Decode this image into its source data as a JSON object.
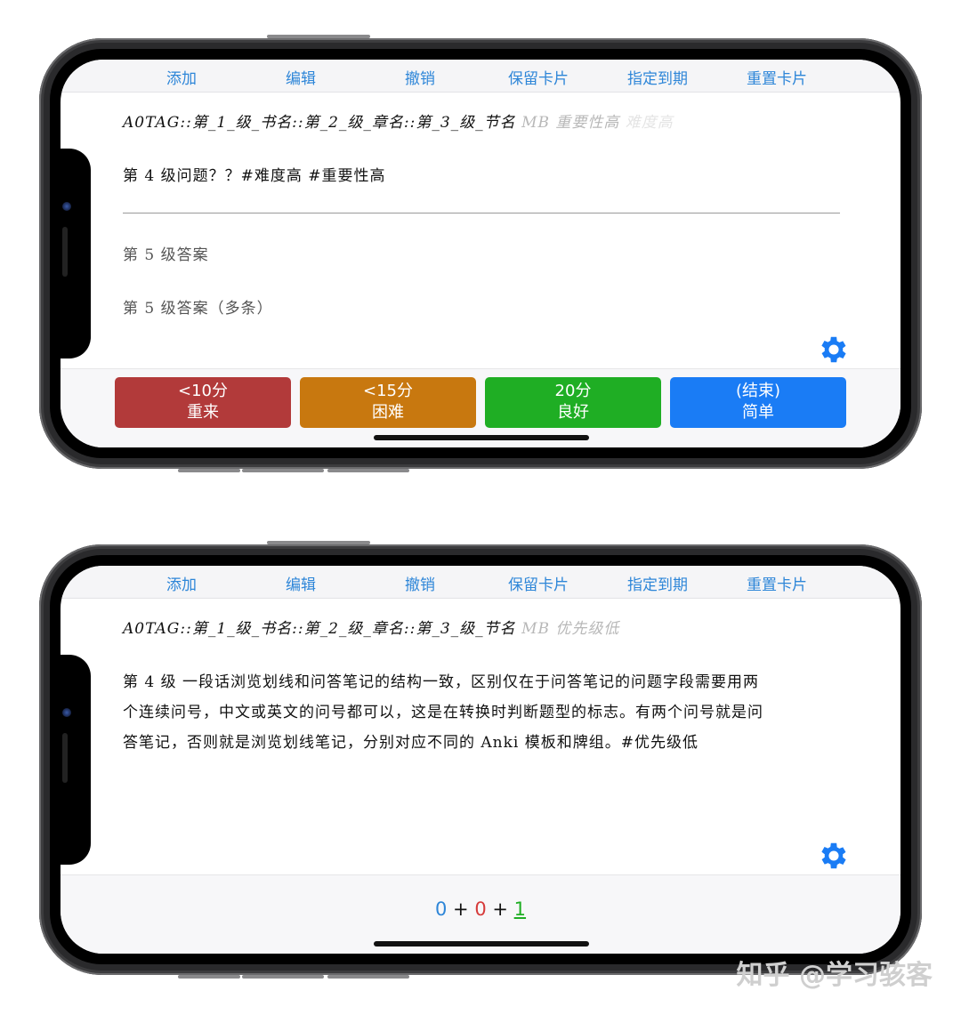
{
  "colors": {
    "toolbar_text": "#2e86d8",
    "again": "#b23a3a",
    "hard": "#c8780f",
    "good": "#1fae24",
    "easy": "#1a7cf5",
    "gear": "#1a7cf5",
    "count_new": "#2e86d8",
    "count_learn": "#d63b3b",
    "count_review": "#1fae24"
  },
  "toolbar": [
    "添加",
    "编辑",
    "撤销",
    "保留卡片",
    "指定到期",
    "重置卡片"
  ],
  "phone1": {
    "tags_main": "A0TAG::第_1_级_书名::第_2_级_章名::第_3_级_节名",
    "tags_fade": "MB 重要性高",
    "tags_fade2": "难度高",
    "question": "第 4 级问题？？#难度高 #重要性高",
    "answer1": "第 5 级答案",
    "answer2": "第 5 级答案（多条）",
    "gear_icon": "gear-icon",
    "buttons": [
      {
        "line1": "<10分",
        "line2": "重来"
      },
      {
        "line1": "<15分",
        "line2": "困难"
      },
      {
        "line1": "20分",
        "line2": "良好"
      },
      {
        "line1": "(结束)",
        "line2": "简单"
      }
    ]
  },
  "phone2": {
    "tags_main": "A0TAG::第_1_级_书名::第_2_级_章名::第_3_级_节名",
    "tags_fade": "MB 优先级低",
    "line1": "第 4 级 一段话浏览划线和问答笔记的结构一致，区别仅在于问答笔记的问题字段需要用两",
    "line2": "个连续问号，中文或英文的问号都可以，这是在转换时判断题型的标志。有两个问号就是问",
    "line3": "答笔记，否则就是浏览划线笔记，分别对应不同的 Anki 模板和牌组。#优先级低",
    "gear_icon": "gear-icon",
    "counts": {
      "new": "0",
      "plus1": "+",
      "learn": "0",
      "plus2": "+",
      "review": "1"
    }
  },
  "watermark": "知乎 @学习骇客"
}
